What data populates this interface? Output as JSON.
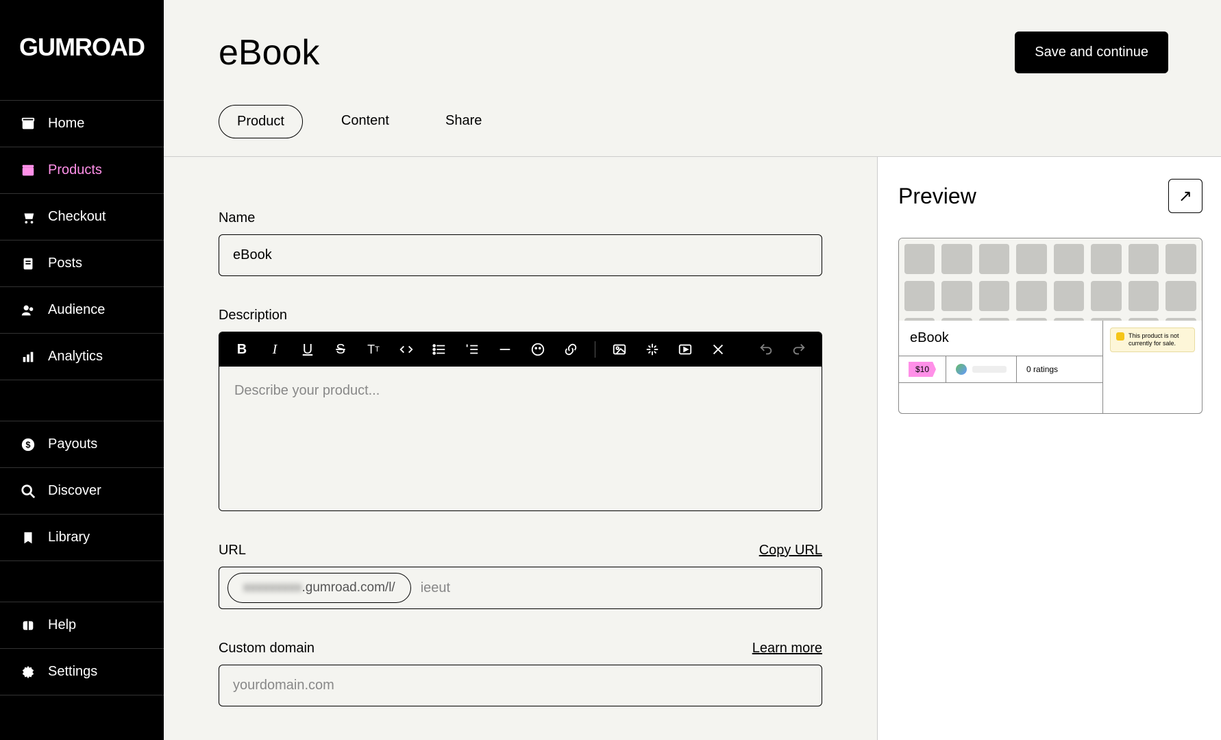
{
  "brand": "GUMROAD",
  "sidebar": {
    "items": [
      {
        "label": "Home",
        "icon": "home"
      },
      {
        "label": "Products",
        "icon": "products",
        "active": true
      },
      {
        "label": "Checkout",
        "icon": "checkout"
      },
      {
        "label": "Posts",
        "icon": "posts"
      },
      {
        "label": "Audience",
        "icon": "audience"
      },
      {
        "label": "Analytics",
        "icon": "analytics"
      }
    ],
    "items2": [
      {
        "label": "Payouts",
        "icon": "payouts"
      },
      {
        "label": "Discover",
        "icon": "discover"
      },
      {
        "label": "Library",
        "icon": "library"
      }
    ],
    "items3": [
      {
        "label": "Help",
        "icon": "help"
      },
      {
        "label": "Settings",
        "icon": "settings"
      }
    ]
  },
  "header": {
    "title": "eBook",
    "save_label": "Save and continue",
    "tabs": [
      {
        "label": "Product",
        "active": true
      },
      {
        "label": "Content"
      },
      {
        "label": "Share"
      }
    ]
  },
  "form": {
    "name_label": "Name",
    "name_value": "eBook",
    "description_label": "Description",
    "description_placeholder": "Describe your product...",
    "url_label": "URL",
    "copy_url_label": "Copy URL",
    "url_prefix_hidden": "xxxxxxxxx",
    "url_prefix_visible": ".gumroad.com/l/",
    "url_slug": "ieeut",
    "custom_domain_label": "Custom domain",
    "learn_more_label": "Learn more",
    "custom_domain_placeholder": "yourdomain.com"
  },
  "preview": {
    "title": "Preview",
    "card_name": "eBook",
    "price": "$10",
    "ratings": "0 ratings",
    "alert": "This product is not currently for sale."
  }
}
